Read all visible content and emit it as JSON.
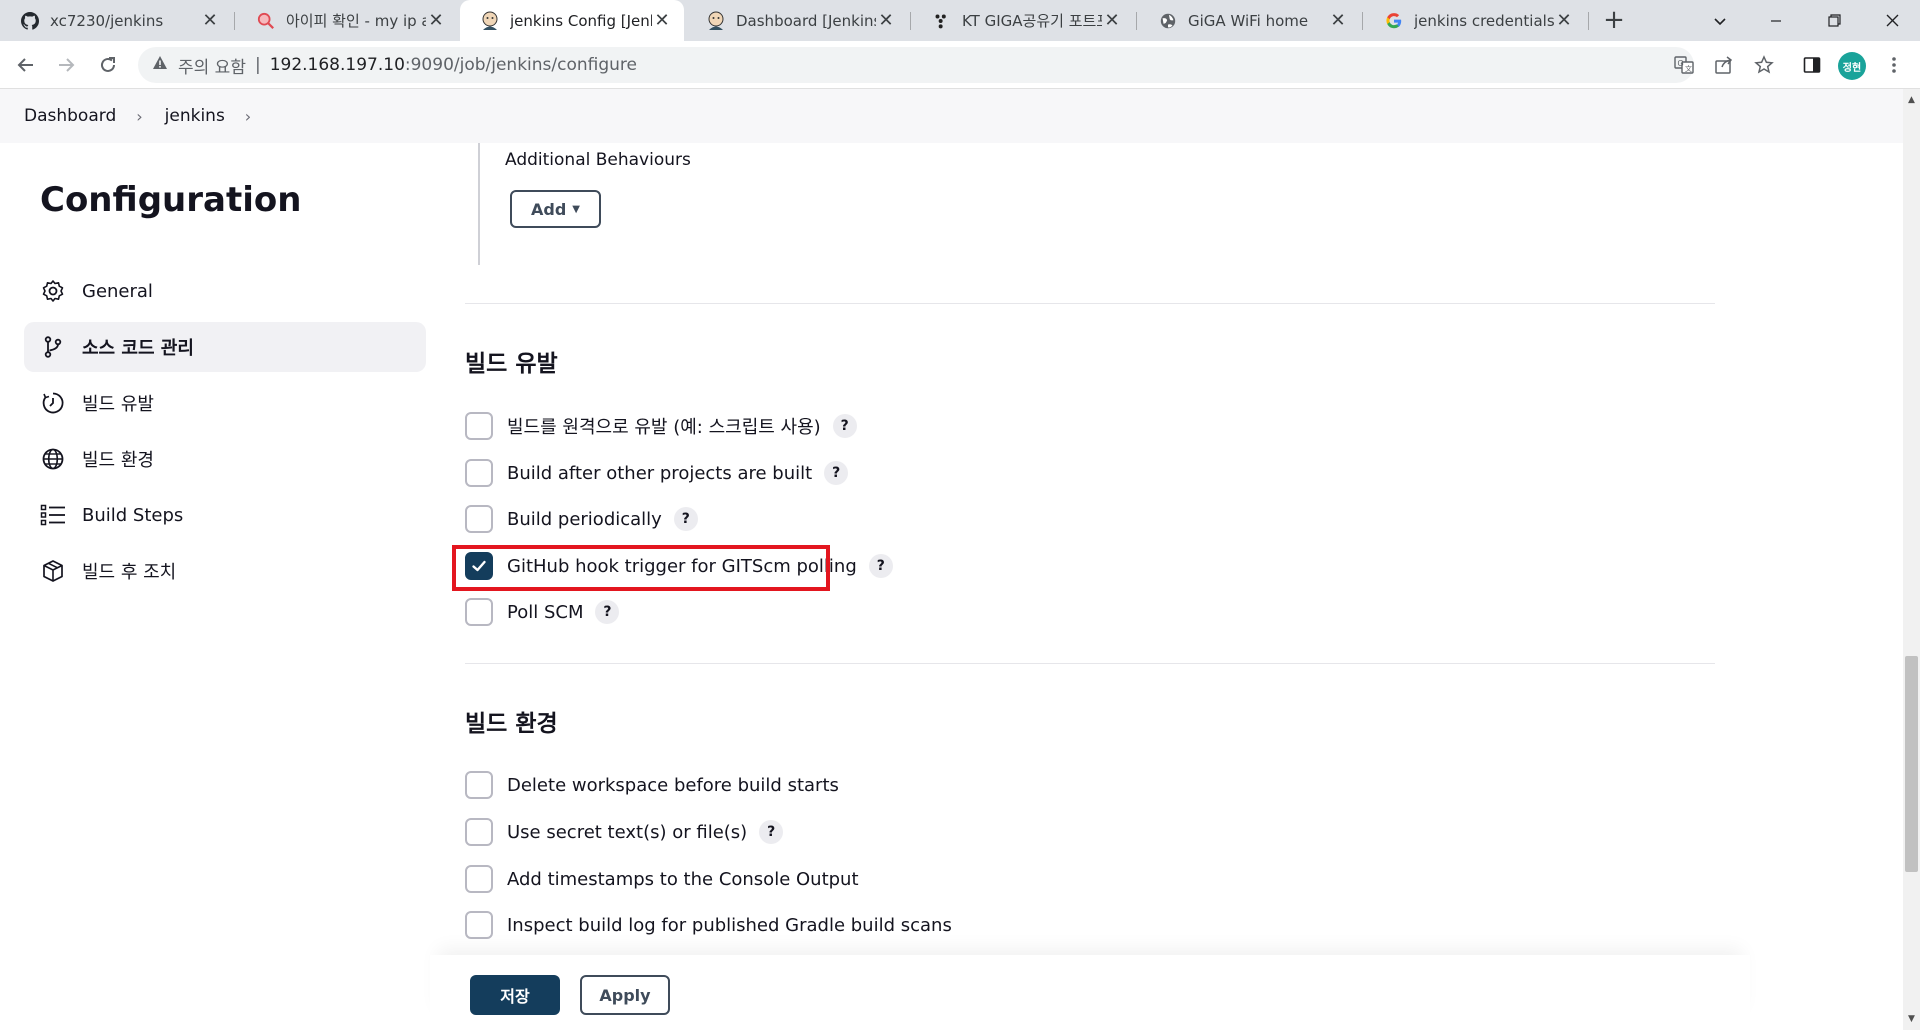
{
  "browser": {
    "tabs": [
      {
        "title": "xc7230/jenkins",
        "icon": "github-icon",
        "active": false
      },
      {
        "title": "아이피 확인 - my ip a",
        "icon": "search-magnifier-icon",
        "active": false
      },
      {
        "title": "jenkins Config [Jenkins]",
        "icon": "jenkins-icon",
        "active": true
      },
      {
        "title": "Dashboard [Jenkins]",
        "icon": "jenkins-icon",
        "active": false
      },
      {
        "title": "KT GIGA공유기 포트포",
        "icon": "kt-icon",
        "active": false
      },
      {
        "title": "GiGA WiFi home",
        "icon": "globe-icon",
        "active": false
      },
      {
        "title": "jenkins credentials 추",
        "icon": "google-icon",
        "active": false
      }
    ],
    "address": {
      "warning": "주의 요함",
      "host": "192.168.197.10",
      "path": ":9090/job/jenkins/configure"
    },
    "profile_initials": "정현"
  },
  "breadcrumb": {
    "items": [
      "Dashboard",
      "jenkins"
    ]
  },
  "page": {
    "title": "Configuration",
    "additional_behaviours": "Additional Behaviours",
    "add_button": "Add"
  },
  "sidebar": {
    "items": [
      {
        "label": "General",
        "icon": "gear-icon"
      },
      {
        "label": "소스 코드 관리",
        "icon": "branch-icon",
        "active": true
      },
      {
        "label": "빌드 유발",
        "icon": "clock-icon"
      },
      {
        "label": "빌드 환경",
        "icon": "globe-icon"
      },
      {
        "label": "Build Steps",
        "icon": "list-icon"
      },
      {
        "label": "빌드 후 조치",
        "icon": "package-icon"
      }
    ]
  },
  "build_triggers": {
    "heading": "빌드 유발",
    "options": [
      {
        "label": "빌드를 원격으로 유발 (예: 스크립트 사용)",
        "checked": false,
        "help": "?"
      },
      {
        "label": "Build after other projects are built",
        "checked": false,
        "help": "?"
      },
      {
        "label": "Build periodically",
        "checked": false,
        "help": "?"
      },
      {
        "label": "GitHub hook trigger for GITScm polling",
        "checked": true,
        "help": "?"
      },
      {
        "label": "Poll SCM",
        "checked": false,
        "help": "?"
      }
    ]
  },
  "build_env": {
    "heading": "빌드 환경",
    "options": [
      {
        "label": "Delete workspace before build starts",
        "checked": false
      },
      {
        "label": "Use secret text(s) or file(s)",
        "checked": false,
        "help": "?"
      },
      {
        "label": "Add timestamps to the Console Output",
        "checked": false
      },
      {
        "label": "Inspect build log for published Gradle build scans",
        "checked": false
      }
    ]
  },
  "actions": {
    "save": "저장",
    "apply": "Apply"
  },
  "colors": {
    "primary": "#143d5c",
    "highlight": "#e3161f"
  }
}
